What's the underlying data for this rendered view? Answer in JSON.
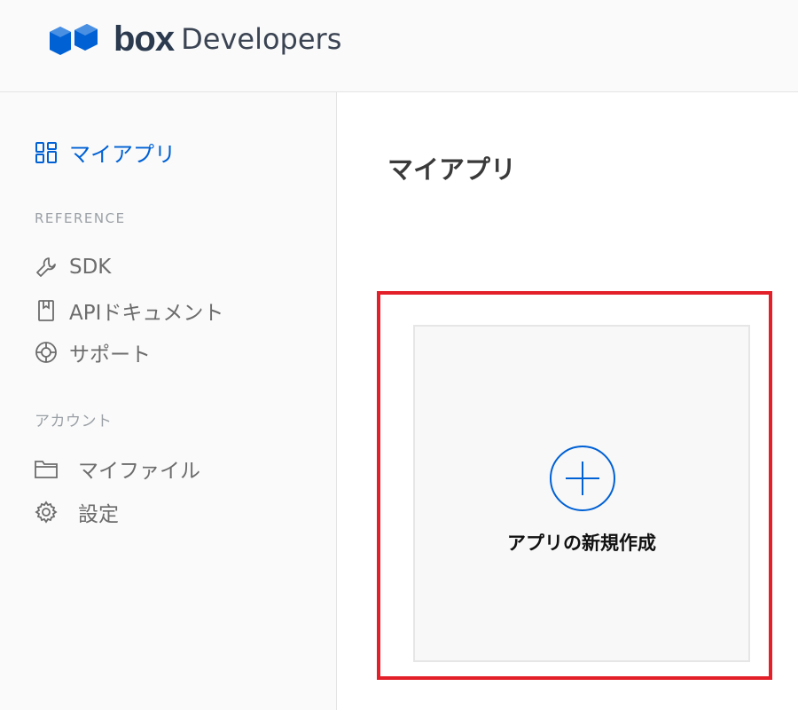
{
  "header": {
    "brand": "box",
    "product": "Developers",
    "brand_color": "#0061d5"
  },
  "sidebar": {
    "my_apps": {
      "label": "マイアプリ",
      "icon": "grid-icon"
    },
    "reference_section": "REFERENCE",
    "reference_items": [
      {
        "label": "SDK",
        "icon": "wrench-icon"
      },
      {
        "label": "APIドキュメント",
        "icon": "bookmark-icon"
      },
      {
        "label": "サポート",
        "icon": "lifebuoy-icon"
      }
    ],
    "account_section": "アカウント",
    "account_items": [
      {
        "label": "マイファイル",
        "icon": "folder-icon"
      },
      {
        "label": "設定",
        "icon": "gear-icon"
      }
    ]
  },
  "main": {
    "title": "マイアプリ",
    "create_card": {
      "label": "アプリの新規作成",
      "icon": "plus-circle-icon"
    }
  },
  "colors": {
    "accent": "#0061d5",
    "highlight": "#e3202a",
    "sidebar_bg": "#fafafa"
  }
}
